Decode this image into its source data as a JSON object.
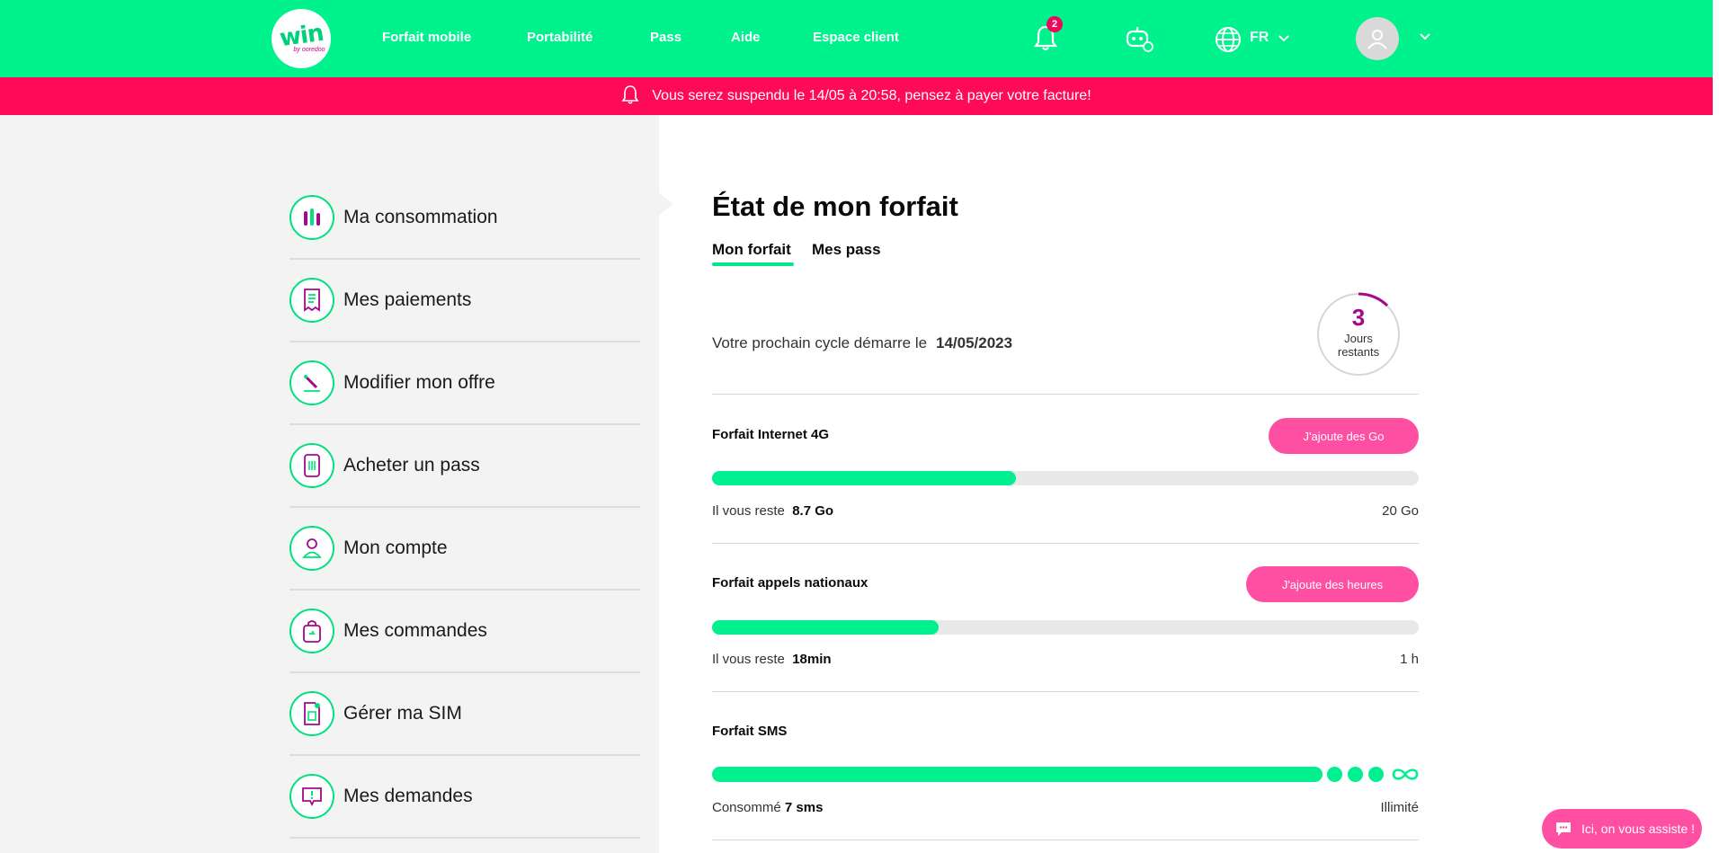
{
  "header": {
    "logo_text": "win",
    "logo_sub": "by ooredoo",
    "nav": [
      "Forfait mobile",
      "Portabilité",
      "Pass",
      "Aide",
      "Espace client"
    ],
    "notification_count": "2",
    "language": "FR",
    "icons": [
      "bell-icon",
      "bot-icon",
      "globe-icon",
      "chevron-down-icon",
      "user-icon"
    ]
  },
  "banner": {
    "text": "Vous serez suspendu le 14/05 à 20:58, pensez à payer votre facture!"
  },
  "sidebar": {
    "items": [
      {
        "label": "Ma consommation",
        "icon": "consumption-icon"
      },
      {
        "label": "Mes paiements",
        "icon": "receipt-icon"
      },
      {
        "label": "Modifier mon offre",
        "icon": "edit-icon"
      },
      {
        "label": "Acheter un pass",
        "icon": "ticket-icon"
      },
      {
        "label": "Mon compte",
        "icon": "account-icon"
      },
      {
        "label": "Mes commandes",
        "icon": "bag-icon"
      },
      {
        "label": "Gérer ma SIM",
        "icon": "sim-icon"
      },
      {
        "label": "Mes demandes",
        "icon": "message-icon"
      }
    ]
  },
  "main": {
    "title": "État de mon forfait",
    "tabs": [
      "Mon forfait",
      "Mes pass"
    ],
    "active_tab": "Mon forfait",
    "cycle_text": "Votre prochain cycle démarre le",
    "cycle_date": "14/05/2023",
    "days_left": "3",
    "days_label_1": "Jours",
    "days_label_2": "restants",
    "internet": {
      "title": "Forfait Internet 4G",
      "button": "J'ajoute des Go",
      "remain_label": "Il vous reste",
      "remain_value": "8.7 Go",
      "total": "20 Go",
      "used_fraction": 0.43
    },
    "calls": {
      "title": "Forfait appels nationaux",
      "button": "J'ajoute des heures",
      "remain_label": "Il vous reste",
      "remain_value": "18min",
      "total": "1 h",
      "used_fraction": 0.32
    },
    "sms": {
      "title": "Forfait SMS",
      "consumed_label": "Consommé",
      "consumed_value": "7 sms",
      "total": "Illimité"
    }
  },
  "chat": {
    "label": "Ici, on vous assiste !"
  },
  "colors": {
    "brand_green": "#00f28c",
    "alert_pink": "#ff0a58",
    "button_pink": "#ff4fa3",
    "accent_purple": "#a30a8a"
  }
}
